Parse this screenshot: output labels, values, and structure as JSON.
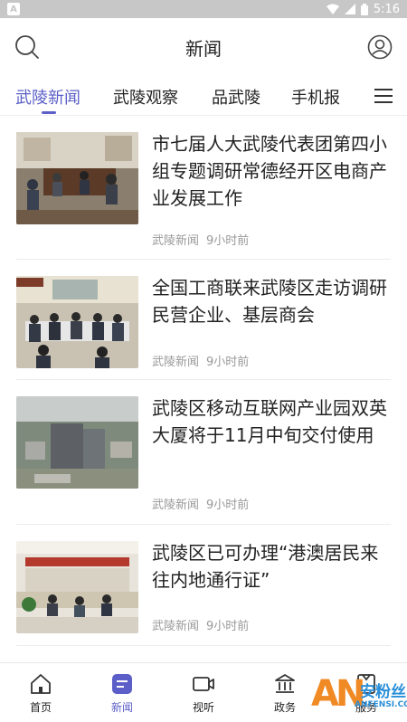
{
  "status_bar": {
    "time": "5:16",
    "left_icon": "A"
  },
  "header": {
    "title": "新闻"
  },
  "tabs": [
    {
      "label": "武陵新闻",
      "active": true
    },
    {
      "label": "武陵观察",
      "active": false
    },
    {
      "label": "品武陵",
      "active": false
    },
    {
      "label": "手机报",
      "active": false
    }
  ],
  "articles": [
    {
      "title": "市七届人大武陵代表团第四小组专题调研常德经开区电商产业发展工作",
      "source": "武陵新闻",
      "time": "9小时前"
    },
    {
      "title": "全国工商联来武陵区走访调研民营企业、基层商会",
      "source": "武陵新闻",
      "time": "9小时前"
    },
    {
      "title": "武陵区移动互联网产业园双英大厦将于11月中旬交付使用",
      "source": "武陵新闻",
      "time": "9小时前"
    },
    {
      "title": "武陵区已可办理“港澳居民来往内地通行证”",
      "source": "武陵新闻",
      "time": "9小时前"
    }
  ],
  "bottom_nav": [
    {
      "label": "首页",
      "icon": "home-icon",
      "active": false
    },
    {
      "label": "新闻",
      "icon": "news-icon",
      "active": true
    },
    {
      "label": "视听",
      "icon": "video-icon",
      "active": false
    },
    {
      "label": "政务",
      "icon": "government-icon",
      "active": false
    },
    {
      "label": "服务",
      "icon": "service-icon",
      "active": false
    }
  ],
  "watermark": {
    "logo": "AN",
    "cn": "安粉丝",
    "en": "ANFENSI.COM"
  },
  "colors": {
    "accent": "#5b5fc7",
    "meta": "#999999",
    "status_bar": "#c7c7c7"
  }
}
